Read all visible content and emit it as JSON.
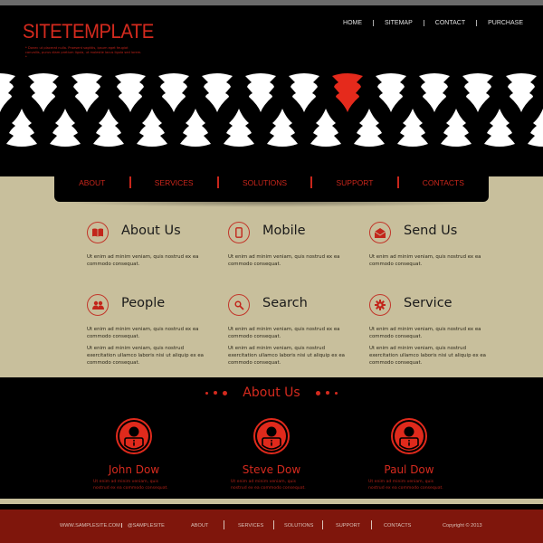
{
  "header": {
    "logo": "SITETEMPLATE",
    "tagline": "* Donec ut placerat nulla. Praesent sagittis, ipsum eget feugiat convallis, purus diam pretium ligula, ut molestie lacus ligula sed lorem. *",
    "top_nav": [
      "HOME",
      "SITEMAP",
      "CONTACT",
      "PURCHASE"
    ]
  },
  "banner": {
    "tree_color": "#ffffff",
    "highlight_color": "#e52a1c"
  },
  "main_nav": [
    "ABOUT",
    "SERVICES",
    "SOLUTIONS",
    "SUPPORT",
    "CONTACTS"
  ],
  "features": [
    {
      "title": "About Us",
      "icon": "book-icon",
      "paragraphs": [
        "Ut enim ad minim veniam, quis nostrud ex ea commodo consequat."
      ]
    },
    {
      "title": "Mobile",
      "icon": "mobile-icon",
      "paragraphs": [
        "Ut enim ad minim veniam, quis nostrud ex ea commodo consequat."
      ]
    },
    {
      "title": "Send Us",
      "icon": "mail-icon",
      "paragraphs": [
        "Ut enim ad minim veniam, quis nostrud ex ea commodo consequat."
      ]
    },
    {
      "title": "People",
      "icon": "people-icon",
      "paragraphs": [
        "Ut enim ad minim veniam, quis nostrud ex ea commodo consequat.",
        "Ut enim ad minim veniam, quis nostrud exercitation ullamco laboris nisi ut aliquip ex ea commodo consequat."
      ]
    },
    {
      "title": "Search",
      "icon": "search-icon",
      "paragraphs": [
        "Ut enim ad minim veniam, quis nostrud ex ea commodo consequat.",
        "Ut enim ad minim veniam, quis nostrud exercitation ullamco laboris nisi ut aliquip ex ea commodo consequat."
      ]
    },
    {
      "title": "Service",
      "icon": "gear-icon",
      "paragraphs": [
        "Ut enim ad minim veniam, quis nostrud ex ea commodo consequat.",
        "Ut enim ad minim veniam, quis nostrud exercitation ullamco laboris nisi ut aliquip ex ea commodo consequat."
      ]
    }
  ],
  "about": {
    "title": "About Us",
    "members": [
      {
        "name": "John Dow",
        "text": "Ut enim ad minim veniam, quis nostrud ex ea commodo consequat."
      },
      {
        "name": "Steve Dow",
        "text": "Ut enim ad minim veniam, quis nostrud ex ea commodo consequat."
      },
      {
        "name": "Paul Dow",
        "text": "Ut enim ad minim veniam, quis nostrud ex ea commodo consequat."
      }
    ]
  },
  "footer": {
    "website": "WWW.SAMPLESITE.COM",
    "social": "@SAMPLESITE",
    "nav": [
      "ABOUT",
      "SERVICES",
      "SOLUTIONS",
      "SUPPORT",
      "CONTACTS"
    ],
    "copyright": "Copyright © 2013"
  },
  "colors": {
    "accent": "#d42a1e",
    "tan": "#c8bf9c",
    "footer": "#7f160c",
    "background": "#000000"
  }
}
